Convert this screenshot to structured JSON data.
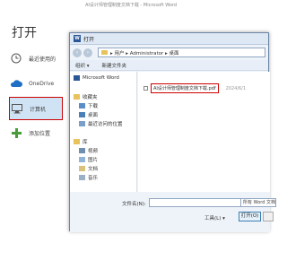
{
  "window": {
    "title": "AI设计师管理制度文档下载 - Microsoft Word"
  },
  "backstage": {
    "title": "打开",
    "items": [
      {
        "label": "最近使用的"
      },
      {
        "label": "OneDrive"
      },
      {
        "label": "计算机"
      },
      {
        "label": "添加位置"
      }
    ]
  },
  "dialog": {
    "title": "打开",
    "address": "▸ 用户 ▸ Administrator ▸ 桌面",
    "toolbar": {
      "organize": "组织 ▾",
      "new_folder": "新建文件夹"
    },
    "nav": {
      "word": "Microsoft Word",
      "favorites": "收藏夹",
      "download": "下载",
      "desktop": "桌面",
      "recent": "最近访问的位置",
      "library": "库",
      "video": "视频",
      "pictures": "图片",
      "docs": "文档",
      "music": "音乐"
    },
    "file": {
      "name": "AI设计师管理制度文档下载.pdf",
      "date": "2024/6/1"
    },
    "filename_label": "文件名(N):",
    "filetype": "所有 Word 文档",
    "tools_label": "工具(L) ▾",
    "open_label": "打开(O)"
  },
  "colors": {
    "accent": "#2b5797",
    "highlight": "#cc0000",
    "selected_bg": "#cfe3f5"
  }
}
